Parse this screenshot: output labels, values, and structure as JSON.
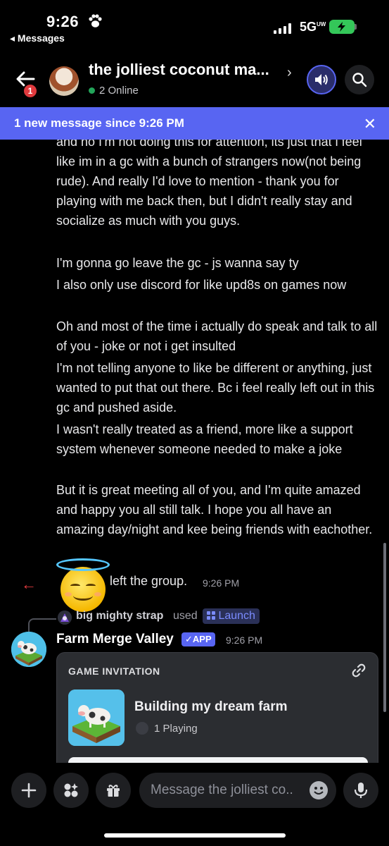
{
  "status_bar": {
    "time": "9:26",
    "back_app": "◂ Messages",
    "network": "5G",
    "network_suffix": "UW"
  },
  "header": {
    "title": "the jolliest coconut ma...",
    "online": "2 Online",
    "unread_badge": "1"
  },
  "banner": {
    "text": "1 new message since 9:26 PM"
  },
  "messages": [
    "and no I'm not doing this for attention, its just that i feel like im in a gc with a bunch of strangers now(not being rude). And really I'd love to mention - thank you for playing with me back then, but I didn't really stay and socialize as much with you guys.",
    "I'm gonna go leave the gc - js wanna say ty",
    "I also only use discord for like upd8s on games now",
    "Oh and most of the time i actually do speak and talk to all of you - joke or not i get insulted",
    "I'm not telling anyone to like be different or anything, just wanted to put that out there. Bc i feel really left out in this gc and pushed aside.",
    "I wasn't really treated as a friend, more like a support system whenever someone needed to make a joke",
    "But it is great meeting all of you, and I'm quite amazed and happy you all still talk. I hope you all have an amazing day/night and kee being friends with eachother."
  ],
  "system": {
    "text": "left the group.",
    "time": "9:26 PM"
  },
  "reply": {
    "name": "big mighty strap",
    "used": "used",
    "command": "Launch"
  },
  "bot": {
    "name": "Farm Merge Valley",
    "tag": "✓APP",
    "time": "9:26 PM"
  },
  "invite": {
    "header": "GAME INVITATION",
    "title": "Building my dream farm",
    "playing": "1 Playing"
  },
  "input": {
    "placeholder": "Message the jolliest co.."
  },
  "colors": {
    "accent": "#5865f2",
    "online": "#23a55a",
    "danger": "#e03a3e"
  },
  "icons": [
    "back-arrow-icon",
    "speaker-icon",
    "search-icon",
    "close-icon",
    "plus-icon",
    "apps-icon",
    "gift-icon",
    "emoji-icon",
    "microphone-icon",
    "link-icon"
  ]
}
